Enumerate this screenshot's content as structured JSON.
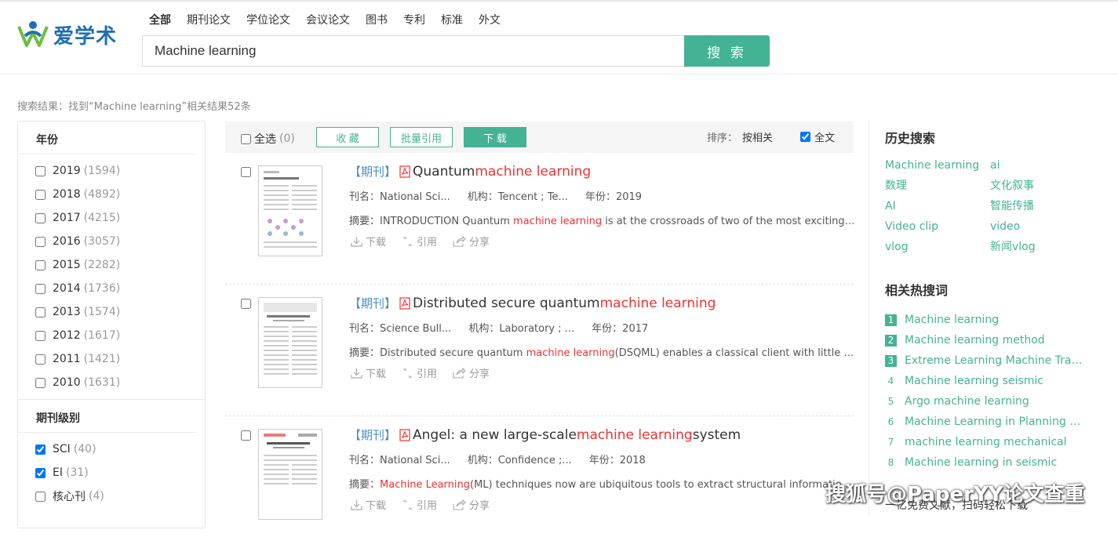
{
  "header": {
    "logo_text": "爱学术",
    "categories": [
      "全部",
      "期刊论文",
      "学位论文",
      "会议论文",
      "图书",
      "专利",
      "标准",
      "外文"
    ],
    "search_value": "Machine learning",
    "search_button": "搜 索"
  },
  "result_info": "搜索结果：找到“Machine learning”相关结果52条",
  "filter": {
    "year_title": "年份",
    "years": [
      {
        "label": "2019",
        "count": "(1594)"
      },
      {
        "label": "2018",
        "count": "(4892)"
      },
      {
        "label": "2017",
        "count": "(4215)"
      },
      {
        "label": "2016",
        "count": "(3057)"
      },
      {
        "label": "2015",
        "count": "(2282)"
      },
      {
        "label": "2014",
        "count": "(1736)"
      },
      {
        "label": "2013",
        "count": "(1574)"
      },
      {
        "label": "2012",
        "count": "(1617)"
      },
      {
        "label": "2011",
        "count": "(1421)"
      },
      {
        "label": "2010",
        "count": "(1631)"
      }
    ],
    "level_title": "期刊级别",
    "levels": [
      {
        "label": "SCI",
        "count": "(40)",
        "checked": true
      },
      {
        "label": "EI",
        "count": "(31)",
        "checked": true
      },
      {
        "label": "核心刊",
        "count": "(4)",
        "checked": false
      }
    ]
  },
  "toolbar": {
    "select_all": "全选",
    "select_count": "(0)",
    "collect": "收 藏",
    "batch_cite": "批量引用",
    "download": "下 载",
    "sort_label": "排序：",
    "sort_value": "按相关",
    "fulltext": "全文"
  },
  "results": [
    {
      "tag": "【期刊】",
      "title_pre": "Quantum ",
      "title_hl": "machine learning",
      "title_post": "",
      "journal": "刊名：National Sci...",
      "org": "机构：Tencent ; Te...",
      "year": "年份：2019",
      "abs_pre": "摘要：INTRODUCTION Quantum ",
      "abs_hl": "machine learning",
      "abs_post": " is at the crossroads of two of the most exciting current areas of research",
      "act_download": "下载",
      "act_cite": "引用",
      "act_share": "分享"
    },
    {
      "tag": "【期刊】",
      "title_pre": "Distributed secure quantum ",
      "title_hl": "machine learning",
      "title_post": "",
      "journal": "刊名：Science Bull...",
      "org": "机构：Laboratory ; ...",
      "year": "年份：2017",
      "abs_pre": "摘要：Distributed secure quantum ",
      "abs_hl": "machine learning",
      "abs_post": "(DSQML) enables a classical client with little quantum technology",
      "act_download": "下载",
      "act_cite": "引用",
      "act_share": "分享"
    },
    {
      "tag": "【期刊】",
      "title_pre": "Angel: a new large-scale ",
      "title_hl": "machine learning",
      "title_post": " system",
      "journal": "刊名：National Sci...",
      "org": "机构：Confidence ;...",
      "year": "年份：2018",
      "abs_pre": "摘要：",
      "abs_hl": "Machine Learning",
      "abs_post": "(ML) techniques now are ubiquitous tools to extract structural information from data",
      "act_download": "下载",
      "act_cite": "引用",
      "act_share": "分享"
    }
  ],
  "history": {
    "title": "历史搜索",
    "items": [
      "Machine learning",
      "ai",
      "数理",
      "文化叙事",
      "AI",
      "智能传播",
      "Video clip",
      "video",
      "vlog",
      "新闻vlog"
    ]
  },
  "hot": {
    "title": "相关热搜词",
    "items": [
      {
        "num": "1",
        "label": "Machine learning"
      },
      {
        "num": "2",
        "label": "Machine learning method"
      },
      {
        "num": "3",
        "label": "Extreme Learning Machine Trading"
      },
      {
        "num": "4",
        "label": "Machine learning seismic"
      },
      {
        "num": "5",
        "label": "Argo machine learning"
      },
      {
        "num": "6",
        "label": "Machine Learning in Planning and ..."
      },
      {
        "num": "7",
        "label": "machine learning mechanical"
      },
      {
        "num": "8",
        "label": "Machine learning in seismic"
      }
    ]
  },
  "watermark": {
    "line1": "搜狐号@PaperYY论文查重",
    "line2": "一亿免费文献，扫码轻松下载"
  },
  "colors": {
    "accent": "#43b394",
    "highlight": "#e33333",
    "tag": "#4a90c2"
  }
}
